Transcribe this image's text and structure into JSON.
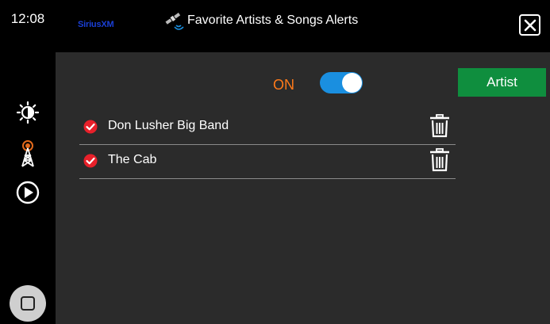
{
  "status": {
    "time": "12:08"
  },
  "rail": {
    "icons": [
      "brightness-icon",
      "radio-tower-icon",
      "play-icon"
    ],
    "home_icon": "home-button-icon"
  },
  "header": {
    "logo_text": "SiriusXM",
    "title": "Favorite Artists & Songs Alerts",
    "close_icon": "close-icon"
  },
  "alerts": {
    "toggle_label": "ON",
    "toggle_state": true,
    "add_button_label": "Artist"
  },
  "favorites": [
    {
      "name": "Don Lusher Big Band",
      "checked": true
    },
    {
      "name": "The Cab",
      "checked": true
    }
  ],
  "colors": {
    "accent_orange": "#ff7a1a",
    "toggle_blue": "#1a8fe0",
    "button_green": "#0f8e3e",
    "check_red": "#e8202a"
  }
}
